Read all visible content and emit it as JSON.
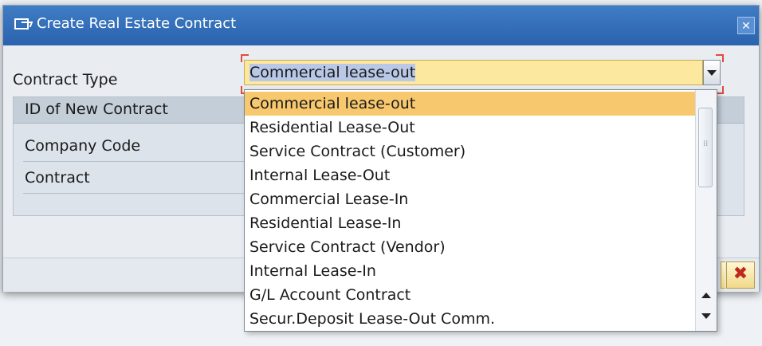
{
  "dialog": {
    "title": "Create Real Estate Contract",
    "close_glyph": "✕"
  },
  "contract_type": {
    "label": "Contract Type",
    "value": "Commercial lease-out"
  },
  "group": {
    "header_label": "ID of New Contract",
    "rows": [
      {
        "label": "Company Code"
      },
      {
        "label": "Contract"
      }
    ]
  },
  "dropdown": {
    "options": [
      {
        "label": "Commercial lease-out",
        "selected": true
      },
      {
        "label": "Residential Lease-Out",
        "selected": false
      },
      {
        "label": "Service Contract (Customer)",
        "selected": false
      },
      {
        "label": "Internal Lease-Out",
        "selected": false
      },
      {
        "label": "Commercial Lease-In",
        "selected": false
      },
      {
        "label": "Residential Lease-In",
        "selected": false
      },
      {
        "label": "Service Contract (Vendor)",
        "selected": false
      },
      {
        "label": "Internal Lease-In",
        "selected": false
      },
      {
        "label": "G/L Account Contract",
        "selected": false
      },
      {
        "label": "Secur.Deposit Lease-Out Comm.",
        "selected": false
      }
    ]
  },
  "footer": {
    "cancel_glyph": "✖"
  },
  "icons": {
    "title": "dialog-window-icon",
    "close": "close-icon",
    "dropdown": "chevron-down-icon",
    "cancel": "cancel-icon"
  },
  "colors": {
    "titlebar": "#2a62ae",
    "selection": "#f7c86e",
    "input_highlight": "#fde8a0",
    "required_bracket": "#e14a3f",
    "cancel_red": "#c0281c"
  }
}
